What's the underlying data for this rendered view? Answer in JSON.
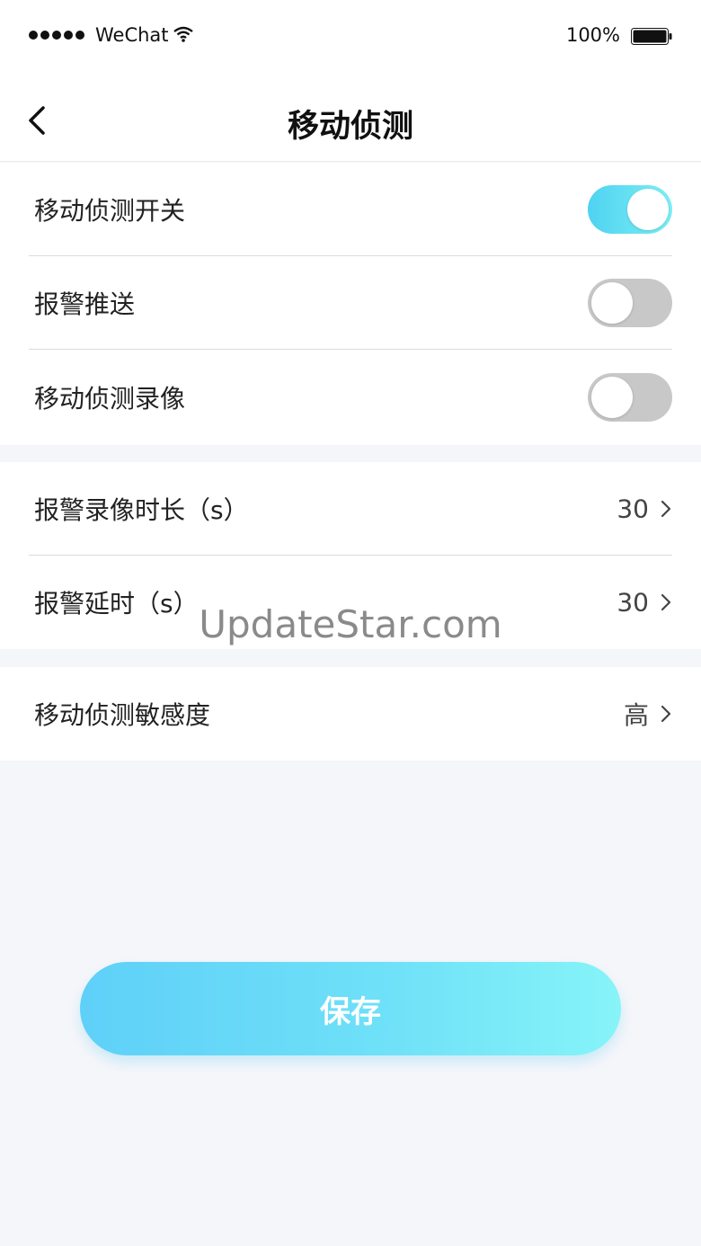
{
  "status_bar": {
    "carrier": "WeChat",
    "battery": "100%"
  },
  "nav": {
    "title": "移动侦测",
    "back_icon": "chevron-left-icon"
  },
  "toggles": [
    {
      "label": "移动侦测开关",
      "on": true
    },
    {
      "label": "报警推送",
      "on": false
    },
    {
      "label": "移动侦测录像",
      "on": false
    }
  ],
  "settings": [
    {
      "label": "报警录像时长（s）",
      "value": "30"
    },
    {
      "label": "报警延时（s）",
      "value": "30"
    }
  ],
  "sensitivity": {
    "label": "移动侦测敏感度",
    "value": "高"
  },
  "watermark": "UpdateStar.com",
  "save_label": "保存",
  "colors": {
    "accent": "#5fd0f8",
    "toggle_off": "#c8c8c8",
    "background": "#f5f6fa"
  }
}
